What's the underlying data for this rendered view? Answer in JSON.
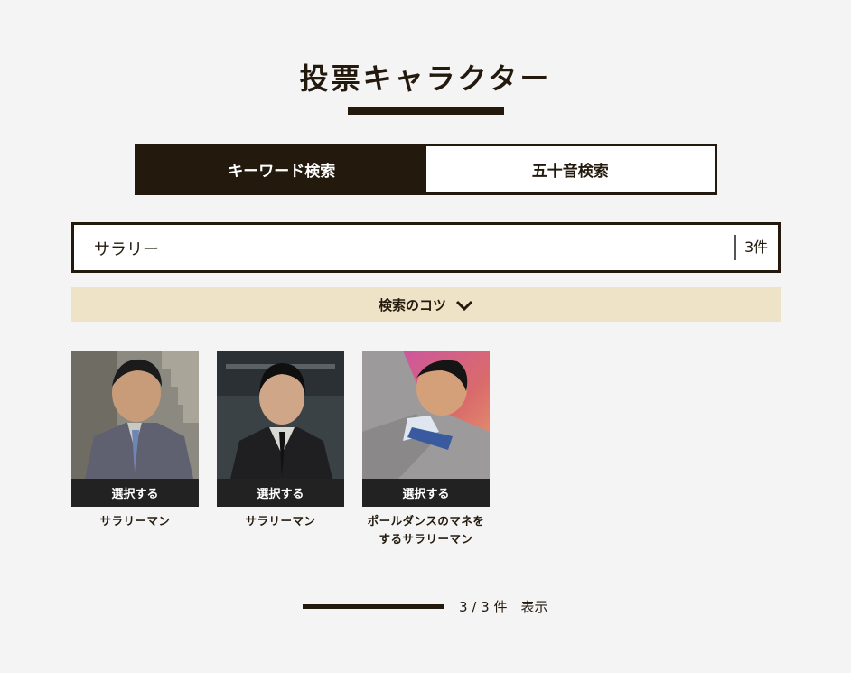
{
  "header": {
    "title": "投票キャラクター"
  },
  "tabs": [
    {
      "label": "キーワード検索",
      "active": true
    },
    {
      "label": "五十音検索",
      "active": false
    }
  ],
  "search": {
    "value": "サラリー",
    "result_count": "3件"
  },
  "tips": {
    "label": "検索のコツ",
    "icon": "chevron-down-icon"
  },
  "results": [
    {
      "select_label": "選択する",
      "name": "サラリーマン"
    },
    {
      "select_label": "選択する",
      "name": "サラリーマン"
    },
    {
      "select_label": "選択する",
      "name_line1": "ポールダンスのマネを",
      "name_line2": "するサラリーマン"
    }
  ],
  "footer": {
    "progress": 1.0,
    "status": "3 / 3 件　表示"
  },
  "colors": {
    "dark": "#231a0d",
    "tips_bg": "#efe3c7",
    "button_bg": "#222222",
    "page_bg": "#f4f4f4"
  }
}
